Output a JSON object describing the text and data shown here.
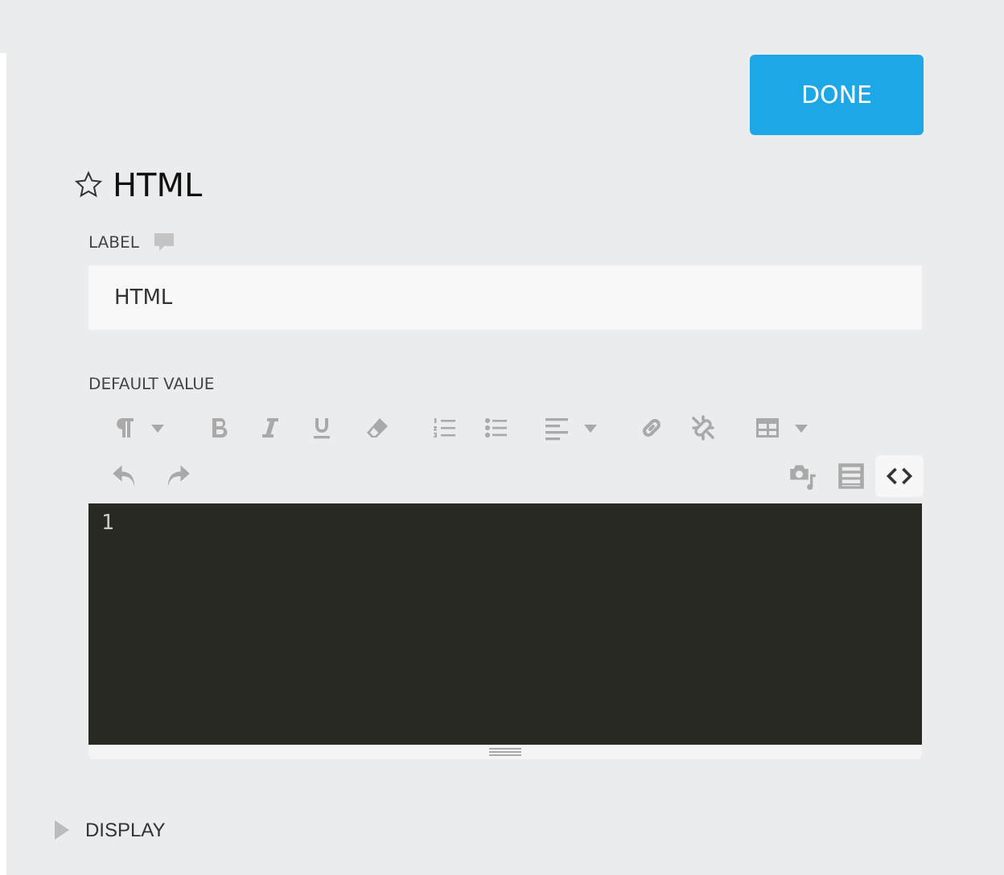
{
  "done_button": "DONE",
  "field": {
    "title": "HTML",
    "favorite": false,
    "label": "LABEL",
    "value": "HTML"
  },
  "default_value": {
    "label": "DEFAULT VALUE",
    "toolbar_rows": [
      [
        {
          "kind": "paragraph",
          "dropdown": true
        },
        {
          "kind": "bold",
          "dropdown": false
        },
        {
          "kind": "italic",
          "dropdown": false
        },
        {
          "kind": "underline",
          "dropdown": false
        },
        {
          "kind": "eraser",
          "dropdown": false
        },
        {
          "kind": "ordered-list",
          "dropdown": false
        },
        {
          "kind": "bullet-list",
          "dropdown": false
        },
        {
          "kind": "align",
          "dropdown": true
        },
        {
          "kind": "link",
          "dropdown": false
        },
        {
          "kind": "unlink",
          "dropdown": false
        },
        {
          "kind": "table",
          "dropdown": true
        }
      ],
      [
        {
          "kind": "undo",
          "selected": false
        },
        {
          "kind": "redo",
          "selected": false
        },
        {
          "kind": "media",
          "selected": false
        },
        {
          "kind": "list-view",
          "selected": false
        },
        {
          "kind": "code",
          "selected": true
        }
      ]
    ],
    "line_numbers": [
      "1"
    ]
  },
  "sections": [
    {
      "title": "DISPLAY",
      "expanded": false
    }
  ]
}
